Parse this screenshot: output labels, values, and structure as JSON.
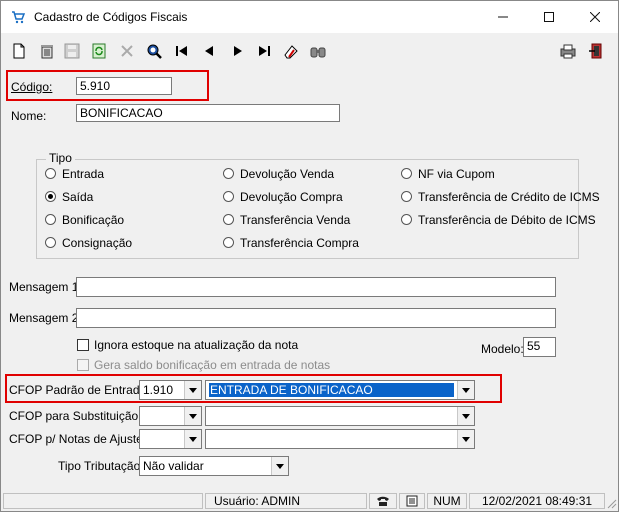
{
  "window": {
    "title": "Cadastro de Códigos Fiscais"
  },
  "toolbar": {
    "icons": [
      "new-icon",
      "delete-icon",
      "save-icon",
      "refresh-icon",
      "cancel-icon",
      "search-icon",
      "first-icon",
      "prev-icon",
      "next-icon",
      "last-icon",
      "clear-icon",
      "find-icon",
      "print-icon",
      "exit-icon"
    ]
  },
  "form": {
    "codigo_label": "Código:",
    "codigo_value": "5.910",
    "nome_label": "Nome:",
    "nome_value": "BONIFICACAO",
    "tipo_label": "Tipo",
    "tipo_options": [
      {
        "label": "Entrada",
        "checked": false
      },
      {
        "label": "Saída",
        "checked": true
      },
      {
        "label": "Bonificação",
        "checked": false
      },
      {
        "label": "Consignação",
        "checked": false
      },
      {
        "label": "Devolução Venda",
        "checked": false
      },
      {
        "label": "Devolução Compra",
        "checked": false
      },
      {
        "label": "Transferência Venda",
        "checked": false
      },
      {
        "label": "Transferência Compra",
        "checked": false
      },
      {
        "label": "NF via Cupom",
        "checked": false
      },
      {
        "label": "Transferência de Crédito de ICMS",
        "checked": false
      },
      {
        "label": "Transferência de Débito de ICMS",
        "checked": false
      }
    ],
    "mensagem1_label": "Mensagem 1:",
    "mensagem1_value": "",
    "mensagem2_label": "Mensagem 2:",
    "mensagem2_value": "",
    "ignora_estoque_label": "Ignora estoque na atualização da nota",
    "ignora_estoque_checked": false,
    "gera_saldo_label": "Gera saldo bonificação em entrada de notas",
    "gera_saldo_enabled": false,
    "modelo_label": "Modelo:",
    "modelo_value": "55",
    "cfop_padrao_label": "CFOP Padrão de Entrada:",
    "cfop_padrao_code": "1.910",
    "cfop_padrao_desc": "ENTRADA DE BONIFICACAO",
    "cfop_subst_label": "CFOP para Substituição:",
    "cfop_subst_code": "",
    "cfop_subst_desc": "",
    "cfop_ajuste_label": "CFOP p/ Notas de Ajuste:",
    "cfop_ajuste_code": "",
    "cfop_ajuste_desc": "",
    "tipo_trib_label": "Tipo Tributação:",
    "tipo_trib_value": "Não validar"
  },
  "statusbar": {
    "usuario": "Usuário: ADMIN",
    "num": "NUM",
    "datetime": "12/02/2021 08:49:31"
  },
  "colors": {
    "highlight": "#e00000",
    "selection": "#0a63c9"
  }
}
